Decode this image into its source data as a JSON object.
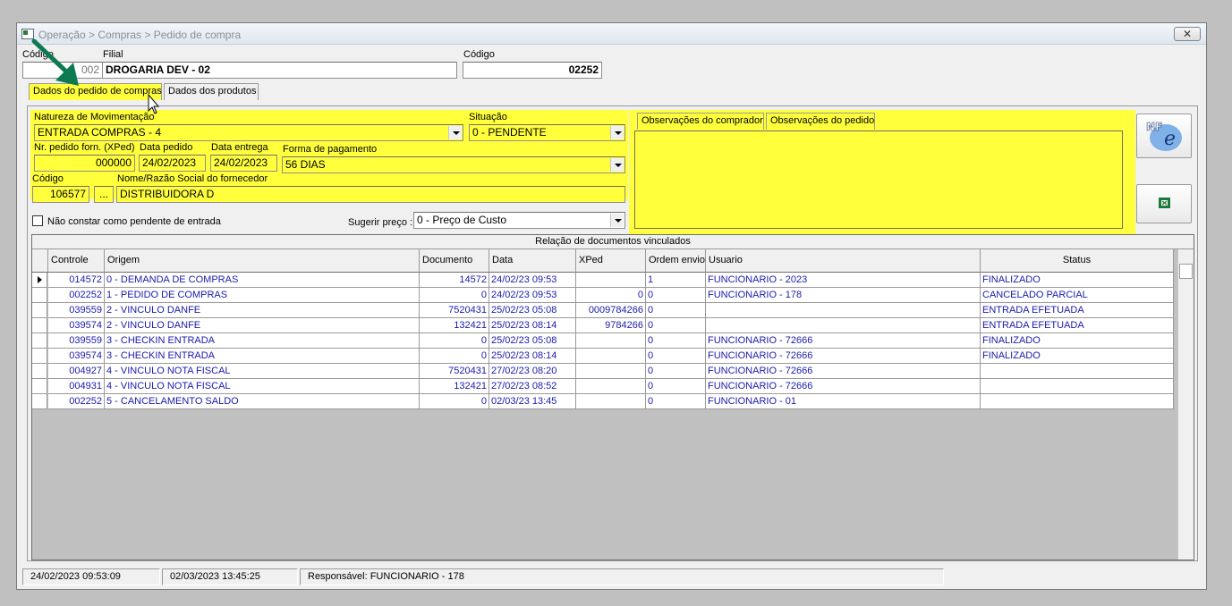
{
  "window": {
    "title": "Operação > Compras > Pedido de compra",
    "close_glyph": "✕"
  },
  "header": {
    "codigo_label": "Código",
    "codigo_value": "002",
    "filial_label": "Filial",
    "filial_value": "DROGARIA DEV - 02",
    "codigo2_label": "Código",
    "codigo2_value": "02252"
  },
  "tabs": [
    {
      "label": "Dados do pedido de compras",
      "active": true
    },
    {
      "label": "Dados dos produtos",
      "active": false
    }
  ],
  "form": {
    "natureza_label": "Natureza de Movimentação",
    "natureza_value": "ENTRADA COMPRAS - 4",
    "situacao_label": "Situação",
    "situacao_value": "0 - PENDENTE",
    "nr_pedido_label": "Nr. pedido forn. (XPed)",
    "nr_pedido_value": "000000",
    "data_pedido_label": "Data pedido",
    "data_pedido_value": "24/02/2023",
    "data_entrega_label": "Data entrega",
    "data_entrega_value": "24/02/2023",
    "forma_pgto_label": "Forma de pagamento",
    "forma_pgto_value": "56 DIAS",
    "codigo_forn_label": "Código",
    "codigo_forn_value": "106577",
    "browse_label": "...",
    "nome_label": "Nome/Razão Social do fornecedor",
    "nome_value": "DISTRIBUIDORA D",
    "nao_constar_label": "Não constar como pendente de entrada",
    "sugerir_label": "Sugerir preço :",
    "sugerir_value": "0 - Preço de Custo"
  },
  "obs_tabs": [
    {
      "label": "Observações do comprador"
    },
    {
      "label": "Observações do pedido"
    }
  ],
  "side_buttons": [
    {
      "icon": "nfe-icon"
    },
    {
      "icon": "excel-icon"
    }
  ],
  "grid": {
    "caption": "Relação de documentos vinculados",
    "columns": [
      "Controle",
      "Origem",
      "Documento",
      "Data",
      "XPed",
      "Ordem envio",
      "Usuario",
      "Status"
    ],
    "rows": [
      [
        "014572",
        "0 - DEMANDA DE COMPRAS",
        "14572",
        "24/02/23 09:53",
        "",
        "1",
        "FUNCIONARIO - 2023",
        "FINALIZADO"
      ],
      [
        "002252",
        "1 - PEDIDO DE COMPRAS",
        "0",
        "24/02/23 09:53",
        "0",
        "0",
        "FUNCIONARIO - 178",
        "CANCELADO PARCIAL"
      ],
      [
        "039559",
        "2 - VINCULO DANFE",
        "7520431",
        "25/02/23 05:08",
        "0009784266",
        "0",
        "",
        "ENTRADA EFETUADA"
      ],
      [
        "039574",
        "2 - VINCULO DANFE",
        "132421",
        "25/02/23 08:14",
        "9784266",
        "0",
        "",
        "ENTRADA EFETUADA"
      ],
      [
        "039559",
        "3 - CHECKIN ENTRADA",
        "0",
        "25/02/23 05:08",
        "",
        "0",
        "FUNCIONARIO - 72666",
        "FINALIZADO"
      ],
      [
        "039574",
        "3 - CHECKIN ENTRADA",
        "0",
        "25/02/23 08:14",
        "",
        "0",
        "FUNCIONARIO - 72666",
        "FINALIZADO"
      ],
      [
        "004927",
        "4 - VINCULO NOTA FISCAL",
        "7520431",
        "27/02/23 08:20",
        "",
        "0",
        "FUNCIONARIO - 72666",
        ""
      ],
      [
        "004931",
        "4 - VINCULO NOTA FISCAL",
        "132421",
        "27/02/23 08:52",
        "",
        "0",
        "FUNCIONARIO - 72666",
        ""
      ],
      [
        "002252",
        "5 - CANCELAMENTO SALDO",
        "0",
        "02/03/23 13:45",
        "",
        "0",
        "FUNCIONARIO - 01",
        ""
      ]
    ]
  },
  "status_bar": {
    "created": "24/02/2023 09:53:09",
    "updated": "02/03/2023 13:45:25",
    "responsavel": "Responsável: FUNCIONARIO - 178"
  },
  "colors": {
    "highlight": "#ffff3c",
    "grid_text": "#1a1ab0",
    "annotation_arrow": "#0e7a52"
  }
}
